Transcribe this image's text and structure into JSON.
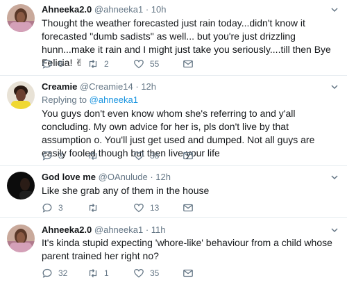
{
  "tweets": [
    {
      "name": "Ahneeka2.0",
      "handle": "@ahneeka1",
      "sep": "·",
      "time": "10h",
      "body": "Thought the weather forecasted just rain today...didn't know it forecasted \"dumb sadists\" as well... but you're just drizzling hunn...make it rain and I might just take you seriously....till then Bye Felicia! ✌",
      "reply_count": "6",
      "retweet_count": "2",
      "like_count": "55"
    },
    {
      "name": "Creamie",
      "handle": "@Creamie14",
      "sep": "·",
      "time": "12h",
      "replying_prefix": "Replying to",
      "replying_handle": "@ahneeka1",
      "body": "You guys don't even know whom she's referring to and y'all concluding. My own advice for her is, pls don't live by that assumption o. You'll just get used and dumped. Not all guys are easily fooled though but then live your life",
      "reply_count": "3",
      "retweet_count": "",
      "like_count": "38"
    },
    {
      "name": "God love me",
      "handle": "@OAnulude",
      "sep": "·",
      "time": "12h",
      "body": "Like she grab any of them in the house",
      "reply_count": "3",
      "retweet_count": "",
      "like_count": "13"
    },
    {
      "name": "Ahneeka2.0",
      "handle": "@ahneeka1",
      "sep": "·",
      "time": "11h",
      "body": "It's kinda stupid expecting 'whore-like' behaviour from a child whose parent trained her right no?",
      "reply_count": "32",
      "retweet_count": "1",
      "like_count": "35"
    }
  ],
  "colors": {
    "link": "#1b95e0",
    "muted": "#657786",
    "divider": "#e6ecf0"
  }
}
